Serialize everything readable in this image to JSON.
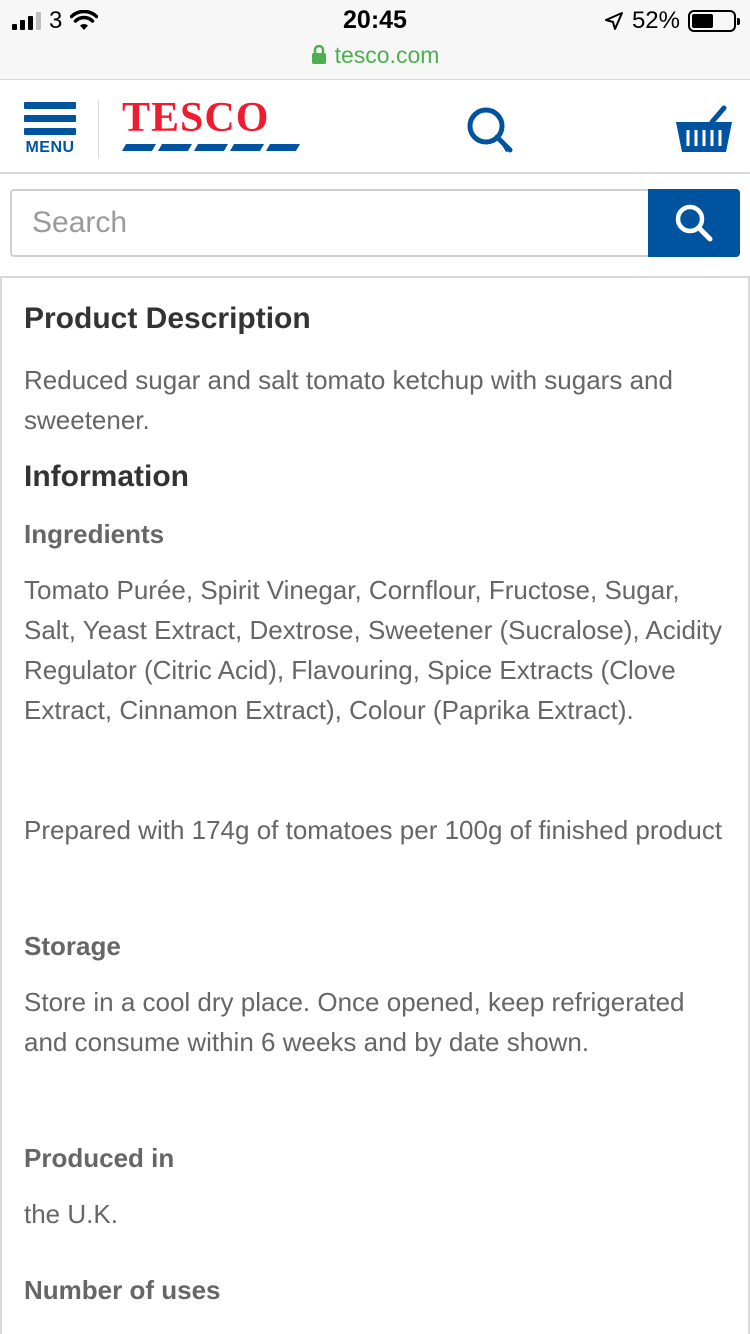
{
  "status_bar": {
    "carrier": "3",
    "time": "20:45",
    "battery": "52%"
  },
  "browser": {
    "url": "tesco.com"
  },
  "header": {
    "menu_label": "MENU",
    "logo_text": "TESCO"
  },
  "search": {
    "placeholder": "Search"
  },
  "content": {
    "description_heading": "Product Description",
    "description_text": "Reduced sugar and salt tomato ketchup with sugars and sweetener.",
    "information_heading": "Information",
    "ingredients_heading": "Ingredients",
    "ingredients_text": "Tomato Purée, Spirit Vinegar, Cornflour, Fructose, Sugar, Salt, Yeast Extract, Dextrose, Sweetener (Sucralose), Acidity Regulator (Citric Acid), Flavouring, Spice Extracts (Clove Extract, Cinnamon Extract), Colour (Paprika Extract).",
    "prepared_text": "Prepared with 174g of tomatoes per 100g of finished product",
    "storage_heading": "Storage",
    "storage_text": "Store in a cool dry place. Once opened, keep refrigerated and consume within 6 weeks and by date shown.",
    "produced_heading": "Produced in",
    "produced_text": "the U.K.",
    "uses_heading": "Number of uses"
  },
  "colors": {
    "brand_blue": "#00539f",
    "brand_red": "#ee1c2e",
    "url_green": "#4caf50"
  }
}
